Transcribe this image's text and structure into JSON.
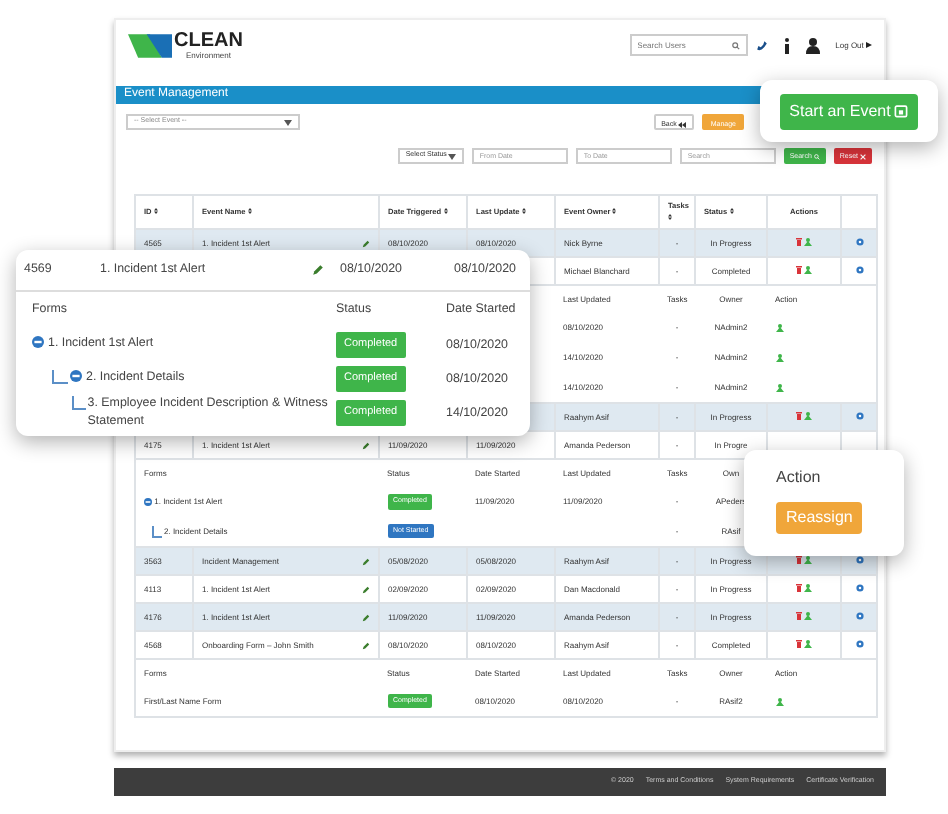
{
  "header": {
    "logo": {
      "name": "CLEAN",
      "tagline": "Environment"
    },
    "search": {
      "placeholder": "Search Users"
    },
    "logout": "Log Out"
  },
  "title_bar": "Event Management",
  "event_select": {
    "placeholder": "-- Select Event --"
  },
  "buttons": [
    {
      "label": "Back",
      "kind": "back"
    },
    {
      "label": "Manage",
      "kind": "manage"
    }
  ],
  "filters": {
    "status": "Select Status",
    "from": {
      "placeholder": "From Date"
    },
    "to": {
      "placeholder": "To Date"
    },
    "search": {
      "placeholder": "Search"
    },
    "search_button": "Search",
    "reset_button": "Reset"
  },
  "table": {
    "columns": [
      {
        "label": "ID",
        "sortable": true
      },
      {
        "label": "Event Name",
        "sortable": true
      },
      {
        "label": "Date Triggered",
        "sortable": true
      },
      {
        "label": "Last Update",
        "sortable": true
      },
      {
        "label": "Event Owner",
        "sortable": true
      },
      {
        "label": "Tasks",
        "sortable": true
      },
      {
        "label": "Status",
        "sortable": true
      },
      {
        "label": "Actions",
        "sortable": false
      }
    ],
    "rows": [
      {
        "id": "4565",
        "name": "1. Incident 1st Alert",
        "triggered": "08/10/2020",
        "updated": "08/10/2020",
        "owner": "Nick Byrne",
        "tasks": "-",
        "status": "In Progress",
        "actions": true
      },
      {
        "owner": "Michael Blanchard",
        "tasks": "-",
        "status": "Completed",
        "actions": true,
        "sub": {
          "headers": {
            "last_updated": "Last Updated",
            "tasks": "Tasks",
            "owner": "Owner",
            "action": "Action"
          },
          "rows": [
            {
              "last_updated": "08/10/2020",
              "tasks": "-",
              "owner": "NAdmin2",
              "action": true
            },
            {
              "last_updated": "14/10/2020",
              "tasks": "-",
              "owner": "NAdmin2",
              "action": true
            },
            {
              "last_updated": "14/10/2020",
              "tasks": "-",
              "owner": "NAdmin2",
              "action": true
            }
          ]
        }
      },
      {
        "owner": "Raahym Asif",
        "tasks": "-",
        "status": "In Progress",
        "actions": true
      },
      {
        "id": "4175",
        "name": "1. Incident 1st Alert",
        "triggered": "11/09/2020",
        "updated": "11/09/2020",
        "owner": "Amanda Pederson",
        "tasks": "-",
        "status": "In Progre",
        "actions": false,
        "sub": {
          "headers": {
            "forms": "Forms",
            "status": "Status",
            "date_started": "Date Started",
            "last_updated": "Last Updated",
            "tasks": "Tasks",
            "owner": "Own"
          },
          "rows": [
            {
              "form": "1. Incident 1st Alert",
              "expanded": true,
              "status": "Completed",
              "kind": "completed",
              "date_started": "11/09/2020",
              "last_updated": "11/09/2020",
              "tasks": "-",
              "owner": "APeders",
              "children": [
                {
                  "form": "2. Incident Details",
                  "status": "Not Started",
                  "kind": "not_started",
                  "tasks": "-",
                  "owner": "RAsif"
                }
              ]
            }
          ]
        }
      },
      {
        "id": "3563",
        "name": "Incident Management",
        "triggered": "05/08/2020",
        "updated": "05/08/2020",
        "owner": "Raahym Asif",
        "tasks": "-",
        "status": "In Progress",
        "actions": true
      },
      {
        "id": "4113",
        "name": "1. Incident 1st Alert",
        "triggered": "02/09/2020",
        "updated": "02/09/2020",
        "owner": "Dan Macdonald",
        "tasks": "-",
        "status": "In Progress",
        "actions": true
      },
      {
        "id": "4176",
        "name": "1. Incident 1st Alert",
        "triggered": "11/09/2020",
        "updated": "11/09/2020",
        "owner": "Amanda Pederson",
        "tasks": "-",
        "status": "In Progress",
        "actions": true
      },
      {
        "id": "4568",
        "name": "Onboarding Form – John Smith",
        "triggered": "08/10/2020",
        "updated": "08/10/2020",
        "owner": "Raahym Asif",
        "tasks": "-",
        "status": "Completed",
        "actions": true,
        "sub": {
          "headers": {
            "forms": "Forms",
            "status": "Status",
            "date_started": "Date Started",
            "last_updated": "Last Updated",
            "tasks": "Tasks",
            "owner": "Owner",
            "action": "Action"
          },
          "rows": [
            {
              "form": "First/Last Name Form",
              "status": "Completed",
              "kind": "completed",
              "date_started": "08/10/2020",
              "last_updated": "08/10/2020",
              "tasks": "-",
              "owner": "RAsif2",
              "action": true
            }
          ]
        }
      }
    ]
  },
  "footer": [
    "© 2020",
    "Terms and Conditions",
    "System Requirements",
    "Certificate Verification"
  ],
  "start_event": {
    "label": "Start an Event"
  },
  "event_card": {
    "id": "4569",
    "name": "1. Incident 1st Alert",
    "triggered": "08/10/2020",
    "updated": "08/10/2020",
    "headers": {
      "forms": "Forms",
      "status": "Status",
      "date_started": "Date Started"
    },
    "forms": [
      {
        "form": "1. Incident 1st Alert",
        "expanded": true,
        "status": "Completed",
        "kind": "completed",
        "date_started": "08/10/2020",
        "children": [
          {
            "form": "2. Incident Details",
            "expanded": true,
            "status": "Completed",
            "kind": "completed",
            "date_started": "08/10/2020",
            "children": [
              {
                "form": "3. Employee Incident Description & Witness Statement",
                "status": "Completed",
                "kind": "completed",
                "date_started": "14/10/2020"
              }
            ]
          }
        ]
      }
    ]
  },
  "action_card": {
    "title": "Action",
    "button": "Reassign"
  }
}
